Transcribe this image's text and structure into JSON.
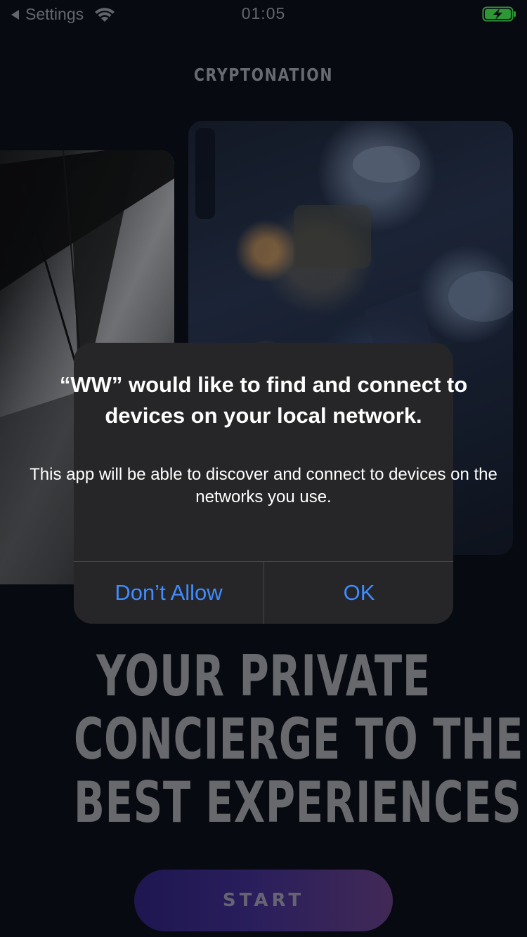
{
  "status_bar": {
    "back_label": "Settings",
    "time": "01:05",
    "icons": [
      "back-arrow-icon",
      "wifi-icon",
      "battery-charging-icon"
    ],
    "battery_color": "#3fd04a"
  },
  "brand": {
    "title": "CRYPTONATION"
  },
  "headline": {
    "line1": "YOUR PRIVATE",
    "line2": "CONCIERGE TO THE",
    "line3": "BEST EXPERIENCES"
  },
  "start_button": {
    "label": "START"
  },
  "alert": {
    "title": "“WW” would like to find and connect to devices on your local network.",
    "message": "This app will be able to discover and connect to devices on the networks you use.",
    "dont_allow_label": "Don’t Allow",
    "ok_label": "OK",
    "accent_color": "#3f8cff"
  }
}
